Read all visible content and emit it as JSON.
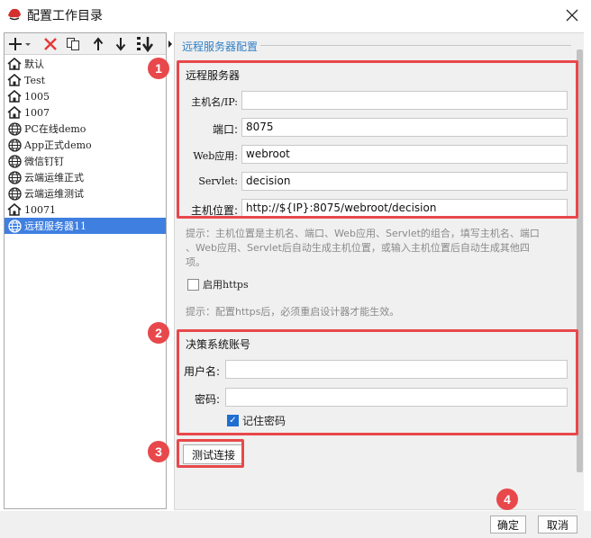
{
  "window": {
    "title": "配置工作目录"
  },
  "tree": {
    "items": [
      {
        "label": "默认",
        "icon": "home-icon"
      },
      {
        "label": "Test",
        "icon": "home-icon"
      },
      {
        "label": "1005",
        "icon": "home-icon"
      },
      {
        "label": "1007",
        "icon": "home-icon"
      },
      {
        "label": "PC在线demo",
        "icon": "globe-icon"
      },
      {
        "label": "App正式demo",
        "icon": "globe-icon"
      },
      {
        "label": "微信钉钉",
        "icon": "globe-icon"
      },
      {
        "label": "云端运维正式",
        "icon": "globe-icon"
      },
      {
        "label": "云端运维测试",
        "icon": "globe-icon"
      },
      {
        "label": "10071",
        "icon": "home-icon"
      },
      {
        "label": "远程服务器11",
        "icon": "globe-icon",
        "selected": true
      }
    ]
  },
  "remote": {
    "section_title": "远程服务器配置",
    "server_group_title": "远程服务器",
    "host_label": "主机名/IP:",
    "host_value": "",
    "port_label": "端口:",
    "port_value": "8075",
    "webapp_label": "Web应用:",
    "webapp_value": "webroot",
    "servlet_label": "Servlet:",
    "servlet_value": "decision",
    "location_label": "主机位置:",
    "location_value": "http://${IP}:8075/webroot/decision",
    "hint_line1": "提示：主机位置是主机名、端口、Web应用、Servlet的组合，填写主机名、端口",
    "hint_line2": "、Web应用、Servlet后自动生成主机位置，或输入主机位置后自动生成其他四",
    "hint_line3": "项。",
    "https_label": "启用https",
    "https_checked": false,
    "https_hint": "提示：配置https后，必须重启设计器才能生效。",
    "account_group_title": "决策系统账号",
    "user_label": "用户名:",
    "user_value": "",
    "password_label": "密码:",
    "password_value": "",
    "remember_label": "记住密码",
    "remember_checked": true,
    "test_button": "测试连接"
  },
  "footer": {
    "ok_button": "确定",
    "cancel_button": "取消"
  },
  "annotations": {
    "badge1": "1",
    "badge2": "2",
    "badge3": "3",
    "badge4": "4"
  },
  "colors": {
    "accent": "#2f80c6",
    "selection": "#3f7fe0",
    "annotation": "#e8484b",
    "delete": "#e53935"
  }
}
